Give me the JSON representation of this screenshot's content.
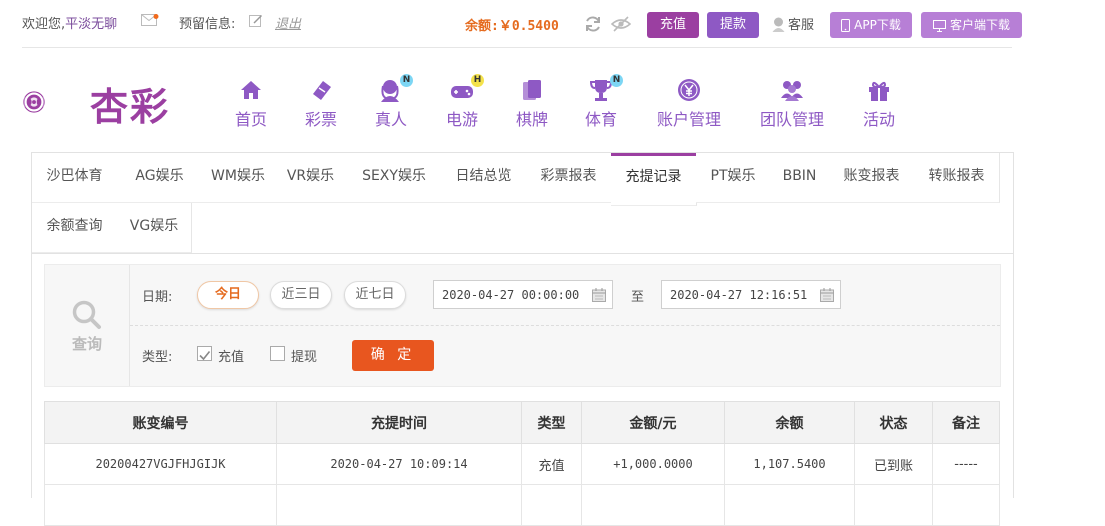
{
  "topbar": {
    "welcome": "欢迎您,",
    "username": "平淡无聊",
    "reserved_label": "预留信息:",
    "logout": "退出",
    "balance_label": "余额:",
    "balance_value": "￥0.5400",
    "recharge": "充值",
    "withdraw": "提款",
    "service": "客服",
    "app_download": "APP下载",
    "client_download": "客户端下载"
  },
  "logo": {
    "text": "杏彩"
  },
  "nav": [
    {
      "label": "首页",
      "icon": "home-icon"
    },
    {
      "label": "彩票",
      "icon": "ticket-icon"
    },
    {
      "label": "真人",
      "icon": "live-dealer-icon",
      "badge": "N"
    },
    {
      "label": "电游",
      "icon": "gamepad-icon",
      "badge": "H"
    },
    {
      "label": "棋牌",
      "icon": "cards-icon"
    },
    {
      "label": "体育",
      "icon": "trophy-icon",
      "badge": "N"
    },
    {
      "label": "账户管理",
      "icon": "yen-coin-icon"
    },
    {
      "label": "团队管理",
      "icon": "team-icon"
    },
    {
      "label": "活动",
      "icon": "gift-icon"
    }
  ],
  "tabs": {
    "row1": [
      "沙巴体育",
      "AG娱乐",
      "WM娱乐",
      "VR娱乐",
      "SEXY娱乐",
      "日结总览",
      "彩票报表",
      "充提记录",
      "PT娱乐",
      "BBIN",
      "账变报表",
      "转账报表"
    ],
    "row2": [
      "余额查询",
      "VG娱乐"
    ],
    "active": "充提记录"
  },
  "query": {
    "label": "查询",
    "date_label": "日期:",
    "today": "今日",
    "last3": "近三日",
    "last7": "近七日",
    "start": "2020-04-27 00:00:00",
    "to": "至",
    "end": "2020-04-27 12:16:51",
    "type_label": "类型:",
    "type_recharge": "充值",
    "type_withdraw": "提现",
    "confirm": "确 定"
  },
  "table": {
    "headers": [
      "账变编号",
      "充提时间",
      "类型",
      "金额/元",
      "余额",
      "状态",
      "备注"
    ],
    "rows": [
      [
        "20200427VGJFHJGIJK",
        "2020-04-27 10:09:14",
        "充值",
        "+1,000.0000",
        "1,107.5400",
        "已到账",
        "-----"
      ]
    ]
  },
  "colors": {
    "accent": "#9b3fa1",
    "orange": "#e56b1f",
    "confirm": "#e8561f",
    "success": "#2f9b30"
  }
}
